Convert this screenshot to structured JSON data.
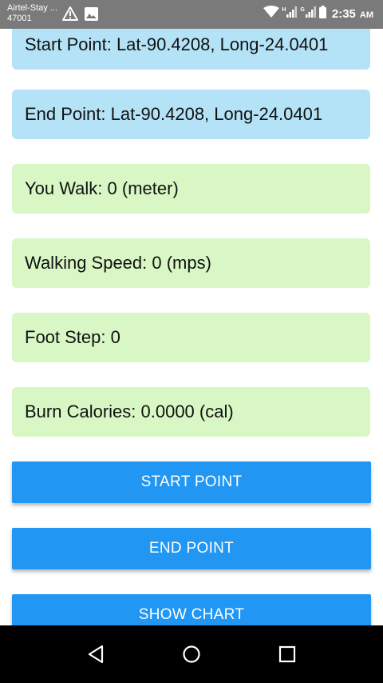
{
  "status_bar": {
    "carrier_line1": "Airtel-Stay ...",
    "carrier_line2": "47001",
    "network_badge_1": "H",
    "network_badge_2": "G",
    "time": "2:35",
    "ampm": "AM",
    "icons": [
      "warning-icon",
      "image-icon",
      "wifi-icon",
      "signal-icon",
      "signal-icon",
      "battery-icon"
    ]
  },
  "cards": {
    "start_point": "Start Point: Lat-90.4208, Long-24.0401",
    "end_point": "End Point: Lat-90.4208, Long-24.0401",
    "you_walk": "You Walk: 0 (meter)",
    "walking_speed": "Walking Speed: 0 (mps)",
    "foot_step": "Foot Step: 0",
    "burn_calories": "Burn Calories: 0.0000 (cal)"
  },
  "buttons": {
    "start_point": "START POINT",
    "end_point": "END POINT",
    "show_chart": "SHOW CHART"
  },
  "colors": {
    "status_bar": "#7a7a7a",
    "location_card": "#b4e2f6",
    "stat_card": "#d8f7c4",
    "button": "#2196f3",
    "nav_bar": "#000000"
  },
  "nav_bar": {
    "icons": [
      "back-icon",
      "home-icon",
      "recents-icon"
    ]
  }
}
